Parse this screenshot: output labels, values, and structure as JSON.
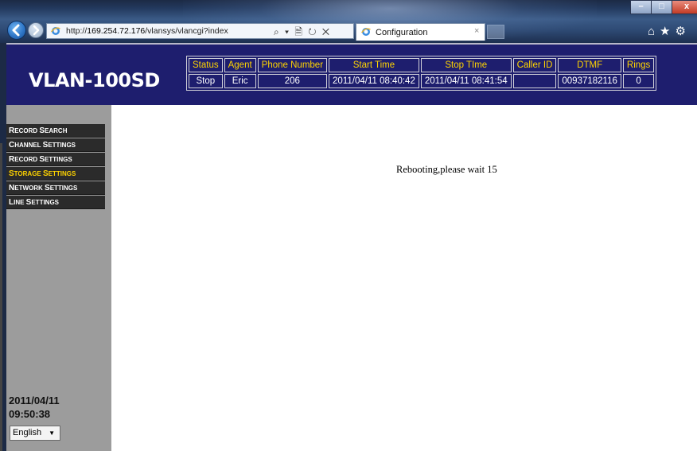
{
  "browser": {
    "url_prefix": "http://",
    "url_host": "169.254.72.176",
    "url_path": "/vlansys/vlancgi?index",
    "addr_tools": "⌕ ▾ 🗎 ↻ ✕",
    "tab_title": "Configuration",
    "tab_close": "×",
    "window_min": "–",
    "window_max": "□",
    "window_close": "x",
    "toolbar_icons": "⌂★⚙"
  },
  "header": {
    "logo": "VLAN-100SD",
    "columns": [
      "Status",
      "Agent",
      "Phone Number",
      "Start Time",
      "Stop TIme",
      "Caller ID",
      "DTMF",
      "Rings"
    ],
    "values": [
      "Stop",
      "Eric",
      "206",
      "2011/04/11 08:40:42",
      "2011/04/11 08:41:54",
      "",
      "00937182116",
      "0"
    ]
  },
  "sidebar": {
    "items": [
      {
        "first": "R",
        "rest": "ECORD ",
        "first2": "S",
        "rest2": "EARCH",
        "active": false
      },
      {
        "first": "C",
        "rest": "HANNEL ",
        "first2": "S",
        "rest2": "ETTINGS",
        "active": false
      },
      {
        "first": "R",
        "rest": "ECORD ",
        "first2": "S",
        "rest2": "ETTINGS",
        "active": false
      },
      {
        "first": "S",
        "rest": "TORAGE ",
        "first2": "S",
        "rest2": "ETTINGS",
        "active": true
      },
      {
        "first": "N",
        "rest": "ETWORK ",
        "first2": "S",
        "rest2": "ETTINGS",
        "active": false
      },
      {
        "first": "L",
        "rest": "INE ",
        "first2": "S",
        "rest2": "ETTINGS",
        "active": false
      }
    ],
    "date": "2011/04/11",
    "time": "09:50:38",
    "language": "English",
    "language_caret": "▼"
  },
  "main": {
    "message": "Rebooting,please wait 15"
  },
  "colors": {
    "header_bg": "#1e1e6e",
    "highlight": "#ffd400",
    "sidebar_bg": "#9c9c9c",
    "menu_bg": "#2b2b2b"
  }
}
